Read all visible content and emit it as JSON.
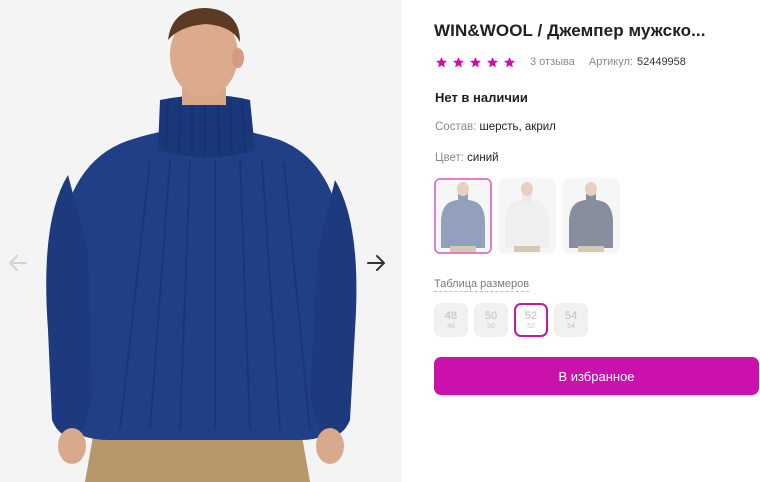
{
  "product": {
    "title": "WIN&WOOL / Джемпер мужско...",
    "rating_stars": 5,
    "reviews": "3 отзыва",
    "article_label": "Артикул:",
    "article_value": "52449958",
    "availability": "Нет в наличии",
    "composition_label": "Состав:",
    "composition_value": "шерсть, акрил",
    "color_label": "Цвет:",
    "color_value": "синий"
  },
  "swatches": [
    {
      "name": "blue",
      "sweater_color": "#3a5487",
      "active": true
    },
    {
      "name": "white",
      "sweater_color": "#e6e6e6",
      "active": false
    },
    {
      "name": "navy",
      "sweater_color": "#2a3350",
      "active": false
    }
  ],
  "size_table_label": "Таблица размеров",
  "sizes": [
    {
      "main": "48",
      "sub": "48",
      "active": false
    },
    {
      "main": "50",
      "sub": "50",
      "active": false
    },
    {
      "main": "52",
      "sub": "52",
      "active": true
    },
    {
      "main": "54",
      "sub": "54",
      "active": false
    }
  ],
  "favorite_button": "В избранное",
  "colors": {
    "accent": "#cb11ab",
    "star": "#cb11ab",
    "sweater": "#1f3f86"
  },
  "icons": {
    "prev": "arrow-left-icon",
    "next": "arrow-right-icon",
    "star": "star-icon"
  }
}
